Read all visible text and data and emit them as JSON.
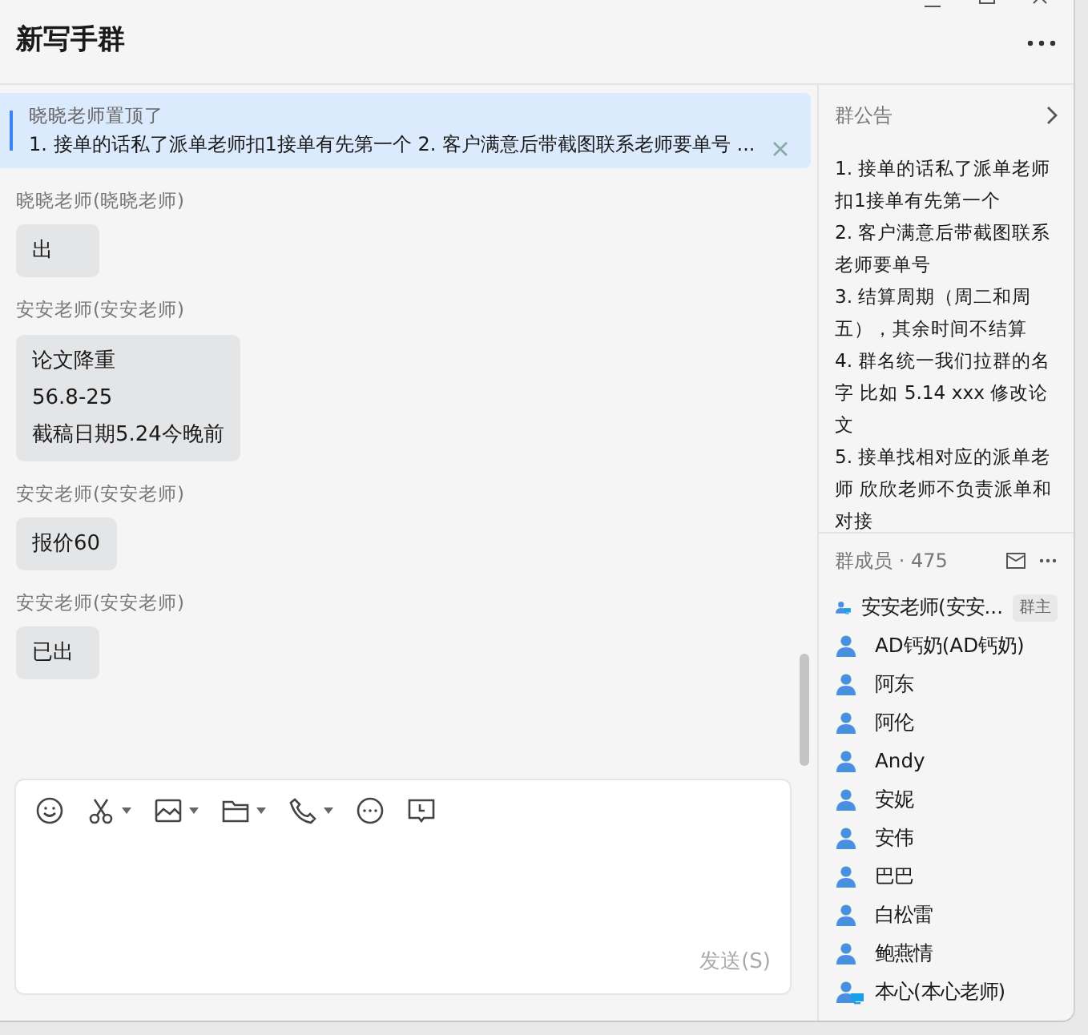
{
  "window": {
    "title": "新写手群"
  },
  "pinned": {
    "author": "晓晓老师置顶了",
    "text": "1. 接单的话私了派单老师扣1接单有先第一个 2. 客户满意后带截图联系老师要单号 ..."
  },
  "messages": [
    {
      "sender": "晓晓老师(晓晓老师)",
      "lines": [
        "出"
      ]
    },
    {
      "sender": "安安老师(安安老师)",
      "lines": [
        "论文降重",
        "56.8-25",
        "截稿日期5.24今晚前"
      ]
    },
    {
      "sender": "安安老师(安安老师)",
      "lines": [
        "报价60"
      ]
    },
    {
      "sender": "安安老师(安安老师)",
      "lines": [
        "已出"
      ]
    }
  ],
  "composer": {
    "tools": [
      {
        "kind": "emoji",
        "dropdown": false
      },
      {
        "kind": "scissors",
        "dropdown": true
      },
      {
        "kind": "image",
        "dropdown": true
      },
      {
        "kind": "folder",
        "dropdown": true
      },
      {
        "kind": "phone",
        "dropdown": true
      },
      {
        "kind": "more",
        "dropdown": false
      },
      {
        "kind": "schedule",
        "dropdown": false
      }
    ],
    "send": "发送(S)"
  },
  "notice": {
    "title": "群公告",
    "items": [
      "1. 接单的话私了派单老师扣1接单有先第一个",
      "2. 客户满意后带截图联系老师要单号",
      "3. 结算周期（周二和周五），其余时间不结算",
      "4. 群名统一我们拉群的名字  比如 5.14 xxx 修改论文",
      "5. 接单找相对应的派单老师 欣欣老师不负责派单和对接"
    ]
  },
  "members": {
    "title": "群成员 · 475",
    "list": [
      {
        "name": "安安老师(安安...",
        "kind": "pc",
        "badge": "群主"
      },
      {
        "name": "AD钙奶(AD钙奶)",
        "kind": "member"
      },
      {
        "name": "阿东",
        "kind": "member"
      },
      {
        "name": "阿伦",
        "kind": "member"
      },
      {
        "name": "Andy",
        "kind": "member"
      },
      {
        "name": "安妮",
        "kind": "member"
      },
      {
        "name": "安伟",
        "kind": "member"
      },
      {
        "name": "巴巴",
        "kind": "member"
      },
      {
        "name": "白松雷",
        "kind": "member"
      },
      {
        "name": "鲍燕情",
        "kind": "member"
      },
      {
        "name": "本心(本心老师)",
        "kind": "pc"
      }
    ]
  }
}
